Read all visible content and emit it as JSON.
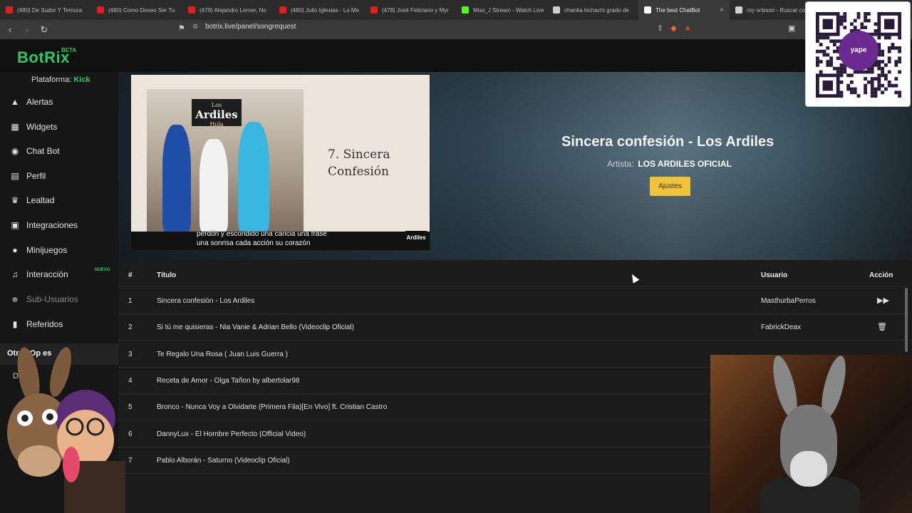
{
  "browser": {
    "tabs": [
      {
        "label": "(480) De Sudor Y Ternura",
        "fav": "#e02020",
        "icon": "youtube-icon"
      },
      {
        "label": "(480) Como Deseo Ser Tu",
        "fav": "#e02020",
        "icon": "youtube-icon"
      },
      {
        "label": "(479) Alejandro Lerner, No",
        "fav": "#e02020",
        "icon": "youtube-icon"
      },
      {
        "label": "(480) Julio Iglesias - Lo Me",
        "fav": "#e02020",
        "icon": "youtube-icon"
      },
      {
        "label": "(478) José Feliciano y Myr",
        "fav": "#e02020",
        "icon": "youtube-icon"
      },
      {
        "label": "Miss_J Stream - Watch Live",
        "fav": "#53fc18",
        "icon": "kick-icon"
      },
      {
        "label": "chanka kichachi grado de",
        "fav": "#cfcfcf",
        "icon": "google-icon"
      },
      {
        "label": "The best ChatBot",
        "fav": "#ffffff",
        "icon": "botrix-icon",
        "active": true
      },
      {
        "label": "roy orbison - Buscar con",
        "fav": "#cfcfcf",
        "icon": "google-icon"
      }
    ],
    "url": "botrix.live/panel/songrequest"
  },
  "app": {
    "logo": "BotRix",
    "beta": "BETA",
    "platform_label": "Plataforma:",
    "platform_value": "Kick",
    "accent": "#2ec866"
  },
  "sidebar": {
    "items": [
      {
        "label": "Alertas",
        "icon": "warning-icon",
        "glyph": "▲"
      },
      {
        "label": "Widgets",
        "icon": "widgets-icon",
        "glyph": "▦"
      },
      {
        "label": "Chat Bot",
        "icon": "robot-icon",
        "glyph": "◉"
      },
      {
        "label": "Perfil",
        "icon": "profile-card-icon",
        "glyph": "▤"
      },
      {
        "label": "Lealtad",
        "icon": "trophy-icon",
        "glyph": "♛"
      },
      {
        "label": "Integraciones",
        "icon": "integrations-icon",
        "glyph": "▣"
      },
      {
        "label": "Minijuegos",
        "icon": "gamepad-icon",
        "glyph": "●"
      },
      {
        "label": "Interacción",
        "icon": "music-note-icon",
        "glyph": "♫"
      },
      {
        "label": "Sub-Usuarios",
        "icon": "users-icon",
        "glyph": "☻",
        "dim": true
      },
      {
        "label": "Referidos",
        "icon": "referral-icon",
        "glyph": "▮"
      }
    ],
    "nuevo_badge": "NUEVO",
    "otras_label": "Otras Op  es",
    "otras_sub": "D   nt"
  },
  "player": {
    "album_brand": "Ardiles",
    "album_brand_top": "Los",
    "album_brand_sub": "Hola",
    "album_track_line1": "7. Sincera",
    "album_track_line2": "Confesión",
    "subtitle_line1": "perdón y escondido una caricia una frase",
    "subtitle_line2": "una sonrisa cada acción su corazón",
    "thumb_logo": "Ardiles",
    "song_title": "Sincera confesión - Los Ardiles",
    "artist_label": "Artista:",
    "artist_value": "LOS ARDILES OFICIAL",
    "settings_button": "Ajustes"
  },
  "qr": {
    "logo_text": "yape"
  },
  "queue": {
    "headers": {
      "num": "#",
      "title": "Título",
      "user": "Usuario",
      "action": "Acción"
    },
    "rows": [
      {
        "num": "1",
        "title": "Sincera confesión - Los Ardiles",
        "user": "MasthurbaPerros",
        "action": "skip-icon",
        "glyph": "▶▶"
      },
      {
        "num": "2",
        "title": "Si tú me quisieras - Nia Vanie & Adrian Bello (Videoclip Oficial)",
        "user": "FabrickDeax",
        "action": "trash-icon",
        "glyph": "🗑"
      },
      {
        "num": "3",
        "title": "Te Regalo Una Rosa ( Juan Luis Guerra )",
        "user": "",
        "action": "",
        "glyph": ""
      },
      {
        "num": "4",
        "title": "Receta de Amor - Olga Tañon by albertolar98",
        "user": "",
        "action": "",
        "glyph": ""
      },
      {
        "num": "5",
        "title": "Bronco - Nunca Voy a Olvidarte (Primera Fila)[En Vivo] ft. Cristian Castro",
        "user": "",
        "action": "",
        "glyph": ""
      },
      {
        "num": "6",
        "title": "DannyLux - El Hombre Perfecto (Official Video)",
        "user": "",
        "action": "",
        "glyph": ""
      },
      {
        "num": "7",
        "title": "Pablo Alborán - Saturno (Videoclip Oficial)",
        "user": "",
        "action": "",
        "glyph": ""
      }
    ]
  }
}
